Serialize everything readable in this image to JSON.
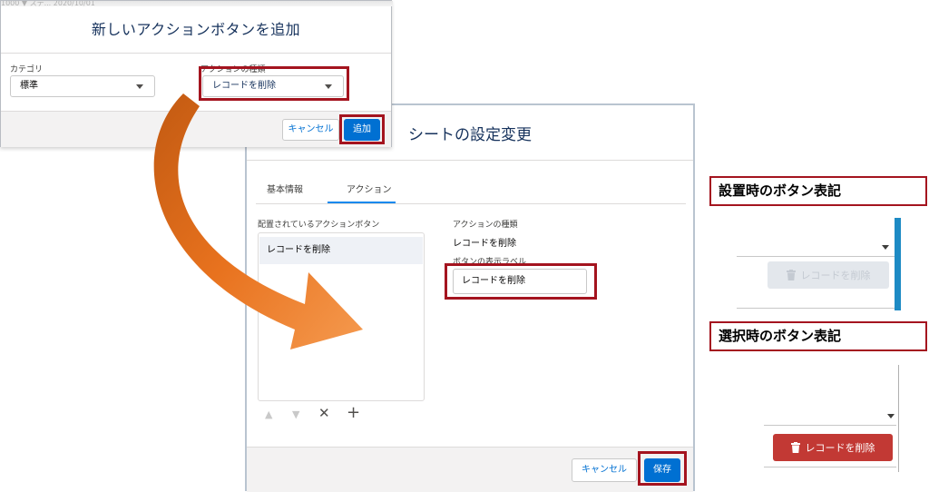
{
  "dialog_add": {
    "background_row_text": "1000    ▼    ステ...    2020/10/01",
    "title": "新しいアクションボタンを追加",
    "category_label": "カテゴリ",
    "category_value": "標準",
    "action_type_label": "アクションの種類",
    "action_type_value": "レコードを削除",
    "cancel_label": "キャンセル",
    "add_label": "追加"
  },
  "dialog_sheet": {
    "title": "シートの設定変更",
    "tabs": [
      "基本情報",
      "アクション"
    ],
    "active_tab": "アクション",
    "placed_buttons_label": "配置されているアクションボタン",
    "placed_buttons": [
      "レコードを削除"
    ],
    "action_type_label": "アクションの種類",
    "action_type_value": "レコードを削除",
    "button_label_label": "ボタンの表示ラベル",
    "button_label_value": "レコードを削除",
    "controls": {
      "up": "▲",
      "down": "▼",
      "remove": "✕",
      "add": "+"
    },
    "cancel_label": "キャンセル",
    "save_label": "保存"
  },
  "annotations": {
    "placed_caption": "設置時のボタン表記",
    "selected_caption": "選択時のボタン表記",
    "placed_button_text": "レコードを削除",
    "selected_button_text": "レコードを削除"
  },
  "colors": {
    "highlight_box": "#a4141f",
    "brand_button": "#0070d2",
    "destructive_button": "#c23934",
    "arrow_orange": "#f07b26",
    "title_navy": "#16325c"
  }
}
